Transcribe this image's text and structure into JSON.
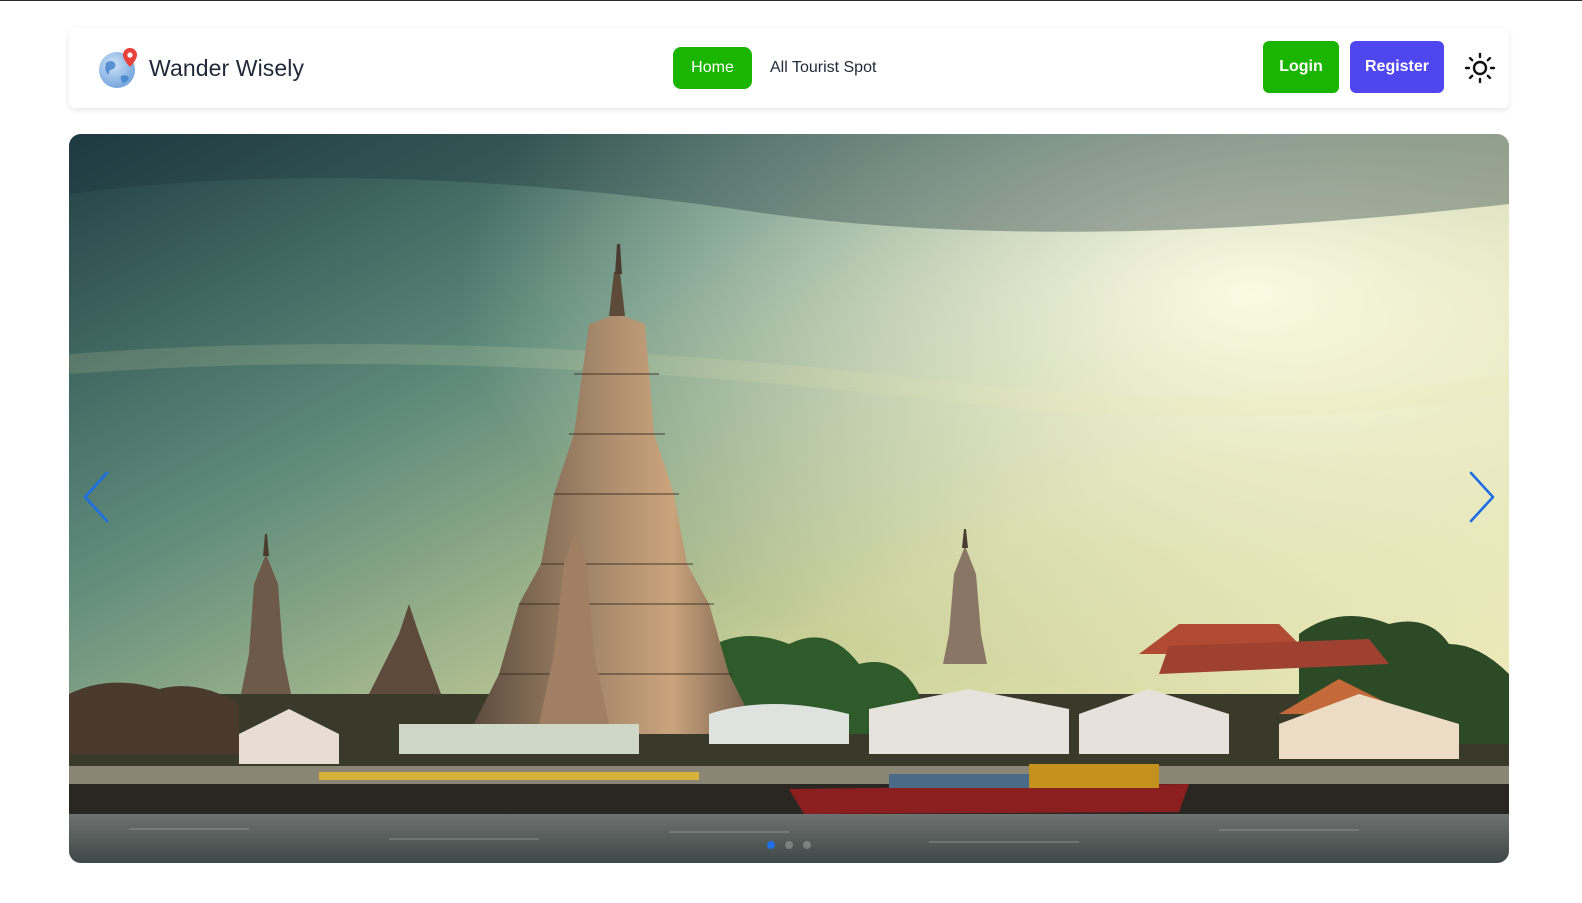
{
  "navbar": {
    "brand_name": "Wander Wisely",
    "links": [
      {
        "label": "Home",
        "active": true
      },
      {
        "label": "All Tourist Spot",
        "active": false
      }
    ],
    "login_label": "Login",
    "register_label": "Register"
  },
  "icons": {
    "logo": "globe-location-icon",
    "theme": "sun-icon",
    "prev": "chevron-left-icon",
    "next": "chevron-right-icon"
  },
  "colors": {
    "accent_green": "#1ab500",
    "accent_indigo": "#4f46f0",
    "arrow_blue": "#1e6ee6"
  },
  "carousel": {
    "slide_count": 3,
    "active_slide": 1
  }
}
